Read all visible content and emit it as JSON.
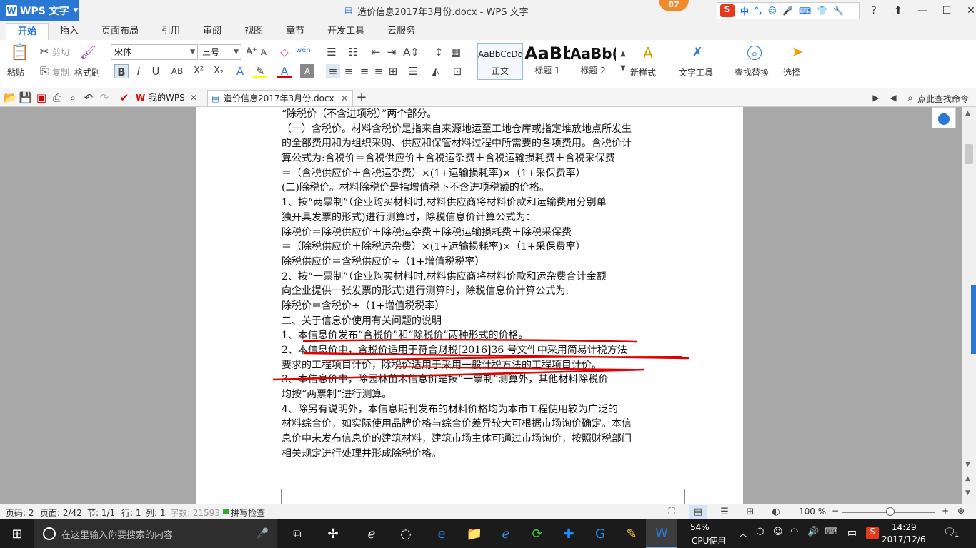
{
  "titlebar": {
    "app_button": "WPS 文字",
    "title": "造价信息2017年3月份.docx - WPS 文字",
    "badge": "87",
    "ime_items": [
      "S",
      "中",
      "°,",
      "☺",
      "🎤",
      "⌨",
      "👕",
      "🔧"
    ]
  },
  "ribbon_tabs": [
    "开始",
    "插入",
    "页面布局",
    "引用",
    "审阅",
    "视图",
    "章节",
    "开发工具",
    "云服务"
  ],
  "ribbon": {
    "paste": "粘贴",
    "cut": "剪切",
    "copy": "复制",
    "format_painter": "格式刷",
    "font_name": "宋体",
    "font_size": "三号",
    "styles": [
      {
        "sample": "AaBbCcDd",
        "label": "正文"
      },
      {
        "sample": "AaBb",
        "label": "标题 1"
      },
      {
        "sample": "AaBb(",
        "label": "标题 2"
      }
    ],
    "new_style": "新样式",
    "text_tools": "文字工具",
    "find_replace": "查找替换",
    "select": "选择"
  },
  "doc_tabs": {
    "my_wps": "我的WPS",
    "current": "造价信息2017年3月份.docx",
    "search_cmd": "点此查找命令"
  },
  "document": {
    "lines": [
      "“除税价（不含进项税）”两个部分。",
      "（一）含税价。材料含税价是指来自来源地运至工地仓库或指定堆放地点所发生",
      "的全部费用和为组织采购、供应和保管材料过程中所需要的各项费用。含税价计",
      "算公式为:含税价＝含税供应价＋含税运杂费＋含税运输损耗费＋含税采保费",
      "            ＝（含税供应价＋含税运杂费）×(1+运输损耗率)×（1+采保费率）",
      "(二)除税价。材料除税价是指增值税下不含进项税额的价格。",
      "    1、按“两票制”（企业购买材料时,材料供应商将材料价款和运输费用分别单",
      "独开具发票的形式)进行测算时，除税信息价计算公式为：",
      "    除税价＝除税供应价＋除税运杂费＋除税运输损耗费＋除税采保费",
      "          ＝（除税供应价＋除税运杂费）×(1+运输损耗率)×（1+采保费率）",
      "    除税供应价＝含税供应价÷（1+增值税税率）",
      "    2、按“一票制”（企业购买材料时,材料供应商将材料价款和运杂费合计金额",
      "向企业提供一张发票的形式)进行测算时，除税信息价计算公式为:",
      "    除税价＝含税价÷（1+增值税税率）",
      "      二、关于信息价使用有关问题的说明",
      "      1、本信息价发布“含税价”和“除税价”两种形式的价格。",
      "      2、本信息价中，含税价适用于符合财税[2016]36 号文件中采用简易计税方法",
      "要求的工程项目计价，除税价适用于采用一般计税方法的工程项目计价。",
      "      3、本信息价中，除园林苗木信息价是按“一票制”测算外，其他材料除税价",
      "均按“两票制”进行测算。",
      "      4、除另有说明外，本信息期刊发布的材料价格均为本市工程使用较为广泛的",
      "材料综合价，如实际使用品牌价格与综合价差异较大可根据市场询价确定。本信",
      "息价中未发布信息价的建筑材料，建筑市场主体可通过市场询价，按照财税部门",
      "相关规定进行处理并形成除税价格。"
    ]
  },
  "statusbar": {
    "page_no": "页码: 2",
    "pages": "页面: 2/42",
    "section": "节: 1/1",
    "row": "行: 1",
    "col": "列: 1",
    "words": "字数: 21593",
    "spell": "拼写检查",
    "zoom": "100 %"
  },
  "taskbar": {
    "search_placeholder": "在这里输入你要搜索的内容",
    "cpu_percent": "54%",
    "cpu_label": "CPU使用",
    "ime": "中",
    "time": "14:29",
    "date": "2017/12/6",
    "notif": "1"
  },
  "colors": {
    "accent": "#2b78d4",
    "annotation_red": "#e00000",
    "taskbar": "#1b1b1b"
  }
}
